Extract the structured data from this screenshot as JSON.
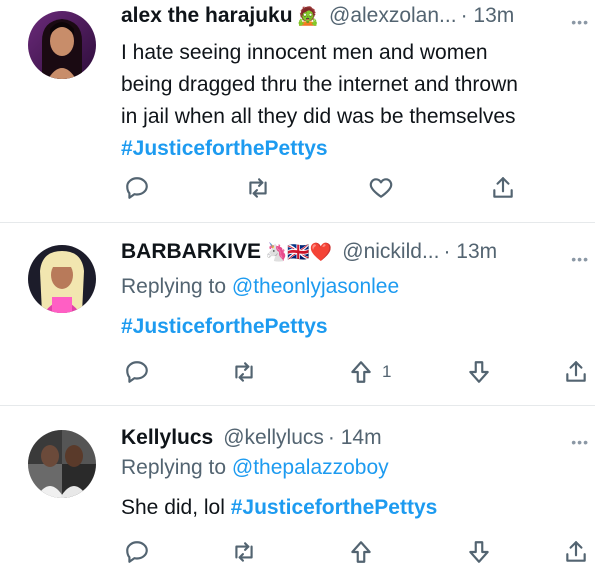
{
  "tweets": [
    {
      "name": "alex the harajuku",
      "emoji": "🧟",
      "handle": "@alexzolan...",
      "time": "· 13m",
      "more": "•••",
      "text_lines": [
        "I hate seeing innocent men and women",
        "being dragged thru the internet and thrown",
        "in jail when all they did was be themselves"
      ],
      "hashtag": "#JusticeforthePettys",
      "actions": [
        "reply-icon",
        "retweet-icon",
        "like-icon",
        "share-icon"
      ]
    },
    {
      "name": "BARBARKIVE",
      "emoji": "🦄🇬🇧❤️",
      "handle": "@nickild...",
      "time": "· 13m",
      "more": "•••",
      "replying_prefix": "Replying to",
      "replying_to": "@theonlyjasonlee",
      "hashtag": "#JusticeforthePettys",
      "upvote_count": "1",
      "actions": [
        "reply-icon",
        "retweet-icon",
        "upvote-icon",
        "downvote-icon",
        "share-icon"
      ]
    },
    {
      "name": "Kellylucs",
      "handle": "@kellylucs",
      "time": "· 14m",
      "more": "•••",
      "replying_prefix": "Replying to",
      "replying_to": "@thepalazzoboy",
      "text": "She did, lol",
      "hashtag": "#JusticeforthePettys",
      "actions": [
        "reply-icon",
        "retweet-icon",
        "upvote-icon",
        "downvote-icon",
        "share-icon"
      ]
    }
  ],
  "colors": {
    "accent": "#1d9bf0",
    "secondary_text": "#536471",
    "primary_text": "#0f1419"
  }
}
